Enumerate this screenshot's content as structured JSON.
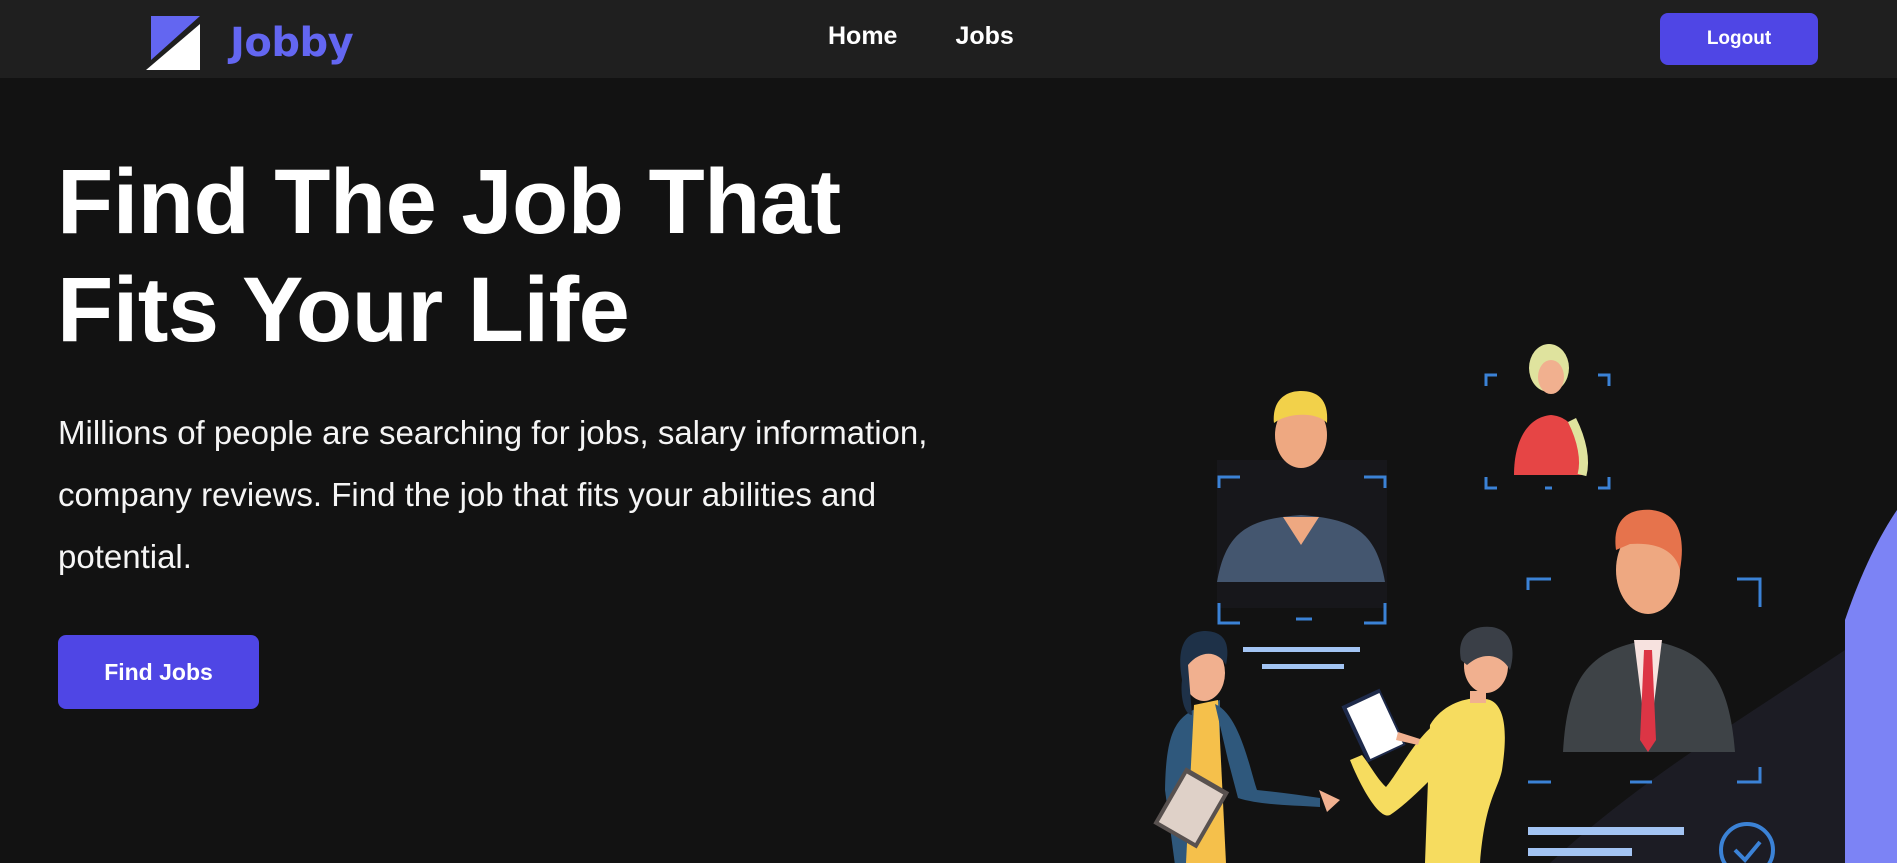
{
  "app": {
    "name": "Jobby"
  },
  "nav": {
    "items": [
      {
        "label": "Home"
      },
      {
        "label": "Jobs"
      }
    ],
    "logout_label": "Logout"
  },
  "hero": {
    "title": "Find The Job That Fits Your Life",
    "description": "Millions of people are searching for jobs, salary information, company reviews. Find the job that fits your abilities and potential.",
    "cta_label": "Find Jobs"
  },
  "colors": {
    "accent": "#4f46e5",
    "logo": "#6366f1",
    "background": "#121212",
    "navbar": "#1f1f1f"
  },
  "icons": {
    "logo_mark": "jobby-logo-icon",
    "illustration": "recruitment-illustration"
  }
}
